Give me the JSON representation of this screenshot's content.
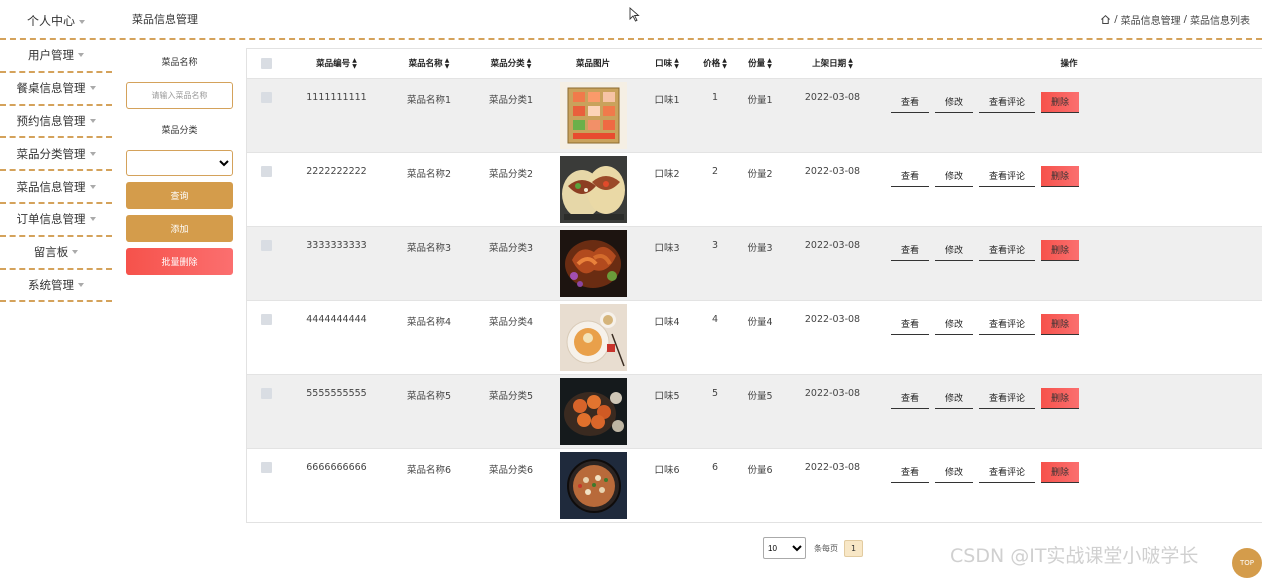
{
  "header": {
    "user_menu": "个人中心",
    "page_title": "菜品信息管理",
    "breadcrumb": {
      "sep1": "/",
      "item1": "菜品信息管理",
      "sep2": "/",
      "item2": "菜品信息列表"
    }
  },
  "sidebar": {
    "items": [
      {
        "label": "用户管理"
      },
      {
        "label": "餐桌信息管理"
      },
      {
        "label": "预约信息管理"
      },
      {
        "label": "菜品分类管理"
      },
      {
        "label": "菜品信息管理"
      },
      {
        "label": "订单信息管理"
      },
      {
        "label": "留言板"
      },
      {
        "label": "系统管理"
      }
    ]
  },
  "filter": {
    "name_label": "菜品名称",
    "name_placeholder": "请输入菜品名称",
    "category_label": "菜品分类",
    "category_value": "",
    "query_button": "查询",
    "add_button": "添加",
    "batch_delete_button": "批量删除"
  },
  "table": {
    "columns": {
      "code": "菜品编号",
      "name": "菜品名称",
      "category": "菜品分类",
      "image": "菜品图片",
      "taste": "口味",
      "price": "价格",
      "portion": "份量",
      "date": "上架日期",
      "actions": "操作"
    },
    "rows": [
      {
        "code": "1111111111",
        "name": "菜品名称1",
        "category": "菜品分类1",
        "taste": "口味1",
        "price": "1",
        "portion": "份量1",
        "date": "2022-03-08"
      },
      {
        "code": "2222222222",
        "name": "菜品名称2",
        "category": "菜品分类2",
        "taste": "口味2",
        "price": "2",
        "portion": "份量2",
        "date": "2022-03-08"
      },
      {
        "code": "3333333333",
        "name": "菜品名称3",
        "category": "菜品分类3",
        "taste": "口味3",
        "price": "3",
        "portion": "份量3",
        "date": "2022-03-08"
      },
      {
        "code": "4444444444",
        "name": "菜品名称4",
        "category": "菜品分类4",
        "taste": "口味4",
        "price": "4",
        "portion": "份量4",
        "date": "2022-03-08"
      },
      {
        "code": "5555555555",
        "name": "菜品名称5",
        "category": "菜品分类5",
        "taste": "口味5",
        "price": "5",
        "portion": "份量5",
        "date": "2022-03-08"
      },
      {
        "code": "6666666666",
        "name": "菜品名称6",
        "category": "菜品分类6",
        "taste": "口味6",
        "price": "6",
        "portion": "份量6",
        "date": "2022-03-08"
      }
    ],
    "actions": {
      "view": "查看",
      "edit": "修改",
      "comments": "查看评论",
      "delete": "删除"
    }
  },
  "pagination": {
    "page_size": "10",
    "per_page_label": "条每页",
    "current_page": "1"
  },
  "watermark": "CSDN @IT实战课堂小啵学长",
  "back_to_top": "TOP",
  "colors": {
    "accent": "#d49c4b",
    "danger": "#f6524b",
    "dashed_border": "#d4a25b"
  }
}
